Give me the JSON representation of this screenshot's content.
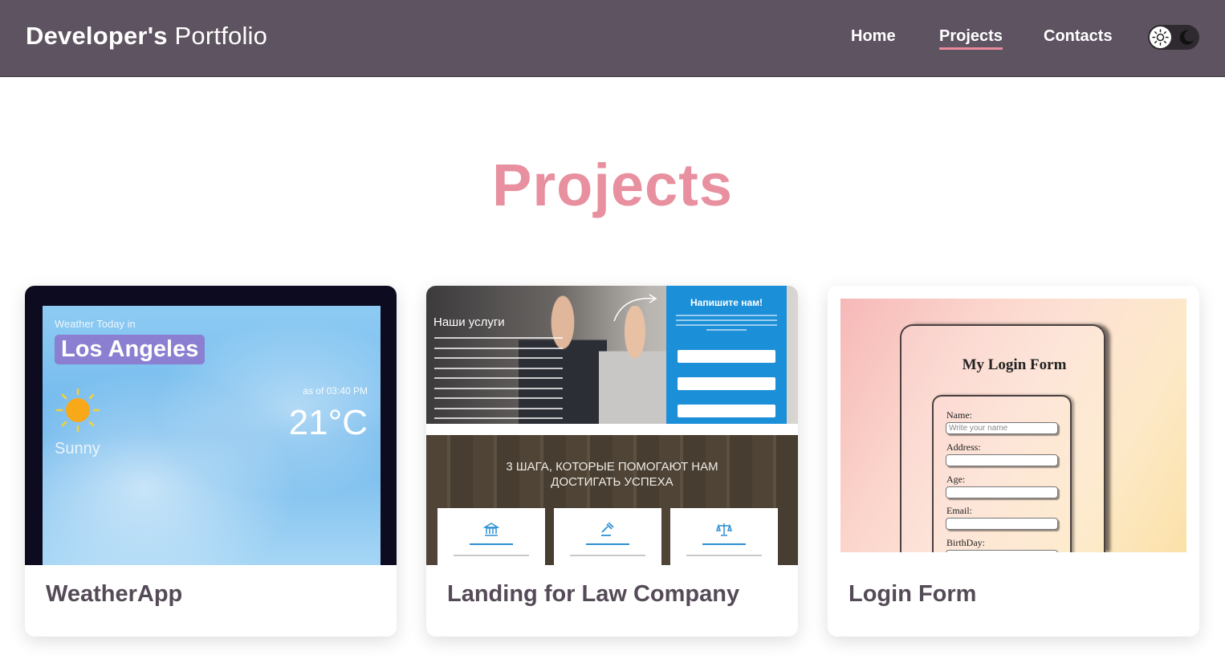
{
  "header": {
    "brand_bold": "Developer's",
    "brand_light": "Portfolio",
    "nav": [
      {
        "label": "Home",
        "active": false
      },
      {
        "label": "Projects",
        "active": true
      },
      {
        "label": "Contacts",
        "active": false
      }
    ],
    "theme_toggle": {
      "left_icon": "sun-icon",
      "right_icon": "moon-icon"
    }
  },
  "page": {
    "title": "Projects",
    "accent_color": "#e8909f",
    "header_color": "#5e5361"
  },
  "projects": [
    {
      "title": "WeatherApp",
      "thumbnail": {
        "caption": "Weather Today in",
        "city": "Los Angeles",
        "condition": "Sunny",
        "time": "as of 03:40 PM",
        "temperature": "21°C"
      }
    },
    {
      "title": "Landing for Law Company",
      "thumbnail": {
        "services_heading": "Наши услуги",
        "form_title": "Напишите нам!",
        "steps_heading_line1": "3 ШАГА, КОТОРЫЕ ПОМОГАЮТ НАМ",
        "steps_heading_line2": "ДОСТИГАТЬ УСПЕХА"
      }
    },
    {
      "title": "Login Form",
      "thumbnail": {
        "form_title": "My Login Form",
        "fields": [
          {
            "label": "Name:",
            "placeholder": "Write your name"
          },
          {
            "label": "Address:",
            "placeholder": ""
          },
          {
            "label": "Age:",
            "placeholder": ""
          },
          {
            "label": "Email:",
            "placeholder": ""
          },
          {
            "label": "BirthDay:",
            "placeholder": ""
          }
        ]
      }
    }
  ]
}
